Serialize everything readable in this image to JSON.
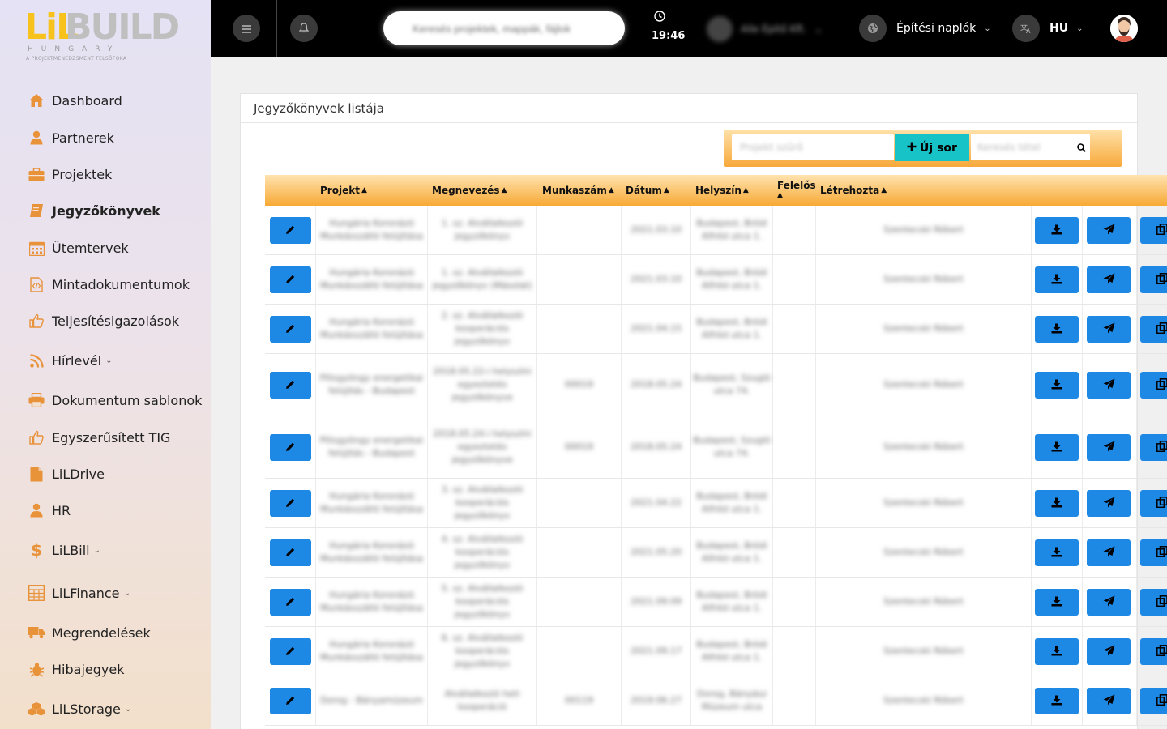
{
  "logo": {
    "mark": "LiL",
    "word": "BUILD",
    "country": "HUNGARY",
    "tagline": "A PROJEKTMENEDZSMENT FELSŐFOKA"
  },
  "sidebar": {
    "items": [
      {
        "label": "Dashboard",
        "icon": "home-icon"
      },
      {
        "label": "Partnerek",
        "icon": "user-icon"
      },
      {
        "label": "Projektek",
        "icon": "briefcase-icon"
      },
      {
        "label": "Jegyzőkönyvek",
        "icon": "book-icon",
        "active": true
      },
      {
        "label": "Ütemtervek",
        "icon": "calendar-icon"
      },
      {
        "label": "Mintadokumentumok",
        "icon": "code-file-icon"
      },
      {
        "label": "Teljesítésigazolások",
        "icon": "thumbs-up-icon"
      },
      {
        "label": "Hírlevél",
        "icon": "rss-icon",
        "caret": true
      },
      {
        "label": "Dokumentum sablonok",
        "icon": "printer-icon"
      },
      {
        "label": "Egyszerűsített TIG",
        "icon": "thumbs-up-icon"
      },
      {
        "label": "LiLDrive",
        "icon": "file-icon"
      },
      {
        "label": "HR",
        "icon": "user-icon"
      },
      {
        "label": "LiLBill",
        "icon": "dollar-icon",
        "caret": true
      },
      {
        "label": "LiLFinance",
        "icon": "calculator-icon",
        "caret": true
      },
      {
        "label": "Megrendelések",
        "icon": "truck-icon"
      },
      {
        "label": "Hibajegyek",
        "icon": "bug-icon"
      },
      {
        "label": "LiLStorage",
        "icon": "cubes-icon",
        "caret": true
      }
    ]
  },
  "topbar": {
    "search_placeholder": "Keresés projektek, mappák, fájlok",
    "time": "19:46",
    "user_name": "Alle Építő Kft.",
    "diaries_label": "Építési naplók",
    "language": "HU"
  },
  "card": {
    "title": "Jegyzőkönyvek listája",
    "filter_placeholder": "Projekt szűrő",
    "new_row_label": "Új sor",
    "search_placeholder": "Keresés tétel"
  },
  "table": {
    "columns": [
      "Projekt",
      "Megnevezés",
      "Munkaszám",
      "Dátum",
      "Helyszín",
      "Felelős",
      "Létrehozta"
    ],
    "rows": [
      {
        "projekt": "Hungária Koronázó Munkásszálló felújítása",
        "megnevezes": "1. sz. Alvállalkozói jegyzőkönyv",
        "munkaszam": "",
        "datum": "2021.03.10",
        "helyszin": "Budapest, Bródi Alfréd utca 1.",
        "felelos": "",
        "letrehozta": "Szentecski Róbert"
      },
      {
        "projekt": "Hungária Koronázó Munkásszálló felújítása",
        "megnevezes": "1. sz. Alvállalkozói jegyzőkönyv (Másolat)",
        "munkaszam": "",
        "datum": "2021.03.10",
        "helyszin": "Budapest, Bródi Alfréd utca 1.",
        "felelos": "",
        "letrehozta": "Szentecski Róbert"
      },
      {
        "projekt": "Hungária Koronázó Munkásszálló felújítása",
        "megnevezes": "2. sz. Alvállalkozói kooperációs jegyzőkönyv",
        "munkaszam": "",
        "datum": "2021.04.15",
        "helyszin": "Budapest, Bródi Alfréd utca 1.",
        "felelos": "",
        "letrehozta": "Szentecski Róbert"
      },
      {
        "projekt": "Pilisgyöngy energetikai felújítás - Budapest",
        "megnevezes": "2018.05.22-i helyszíni egyeztetés jegyzőkönyve",
        "munkaszam": "00019",
        "datum": "2018.05.24",
        "helyszin": "Budapest, Szugló utca 74.",
        "felelos": "",
        "letrehozta": "Szentecski Róbert"
      },
      {
        "projekt": "Pilisgyöngy energetikai felújítás - Budapest",
        "megnevezes": "2018.05.24-i helyszíni egyeztetés jegyzőkönyve",
        "munkaszam": "00019",
        "datum": "2018.05.24",
        "helyszin": "Budapest, Szugló utca 74.",
        "felelos": "",
        "letrehozta": "Szentecski Róbert"
      },
      {
        "projekt": "Hungária Koronázó Munkásszálló felújítása",
        "megnevezes": "3. sz. Alvállalkozói kooperációs jegyzőkönyv",
        "munkaszam": "",
        "datum": "2021.04.22",
        "helyszin": "Budapest, Bródi Alfréd utca 1.",
        "felelos": "",
        "letrehozta": "Szentecski Róbert"
      },
      {
        "projekt": "Hungária Koronázó Munkásszálló felújítása",
        "megnevezes": "4. sz. Alvállalkozói kooperációs jegyzőkönyv",
        "munkaszam": "",
        "datum": "2021.05.20",
        "helyszin": "Budapest, Bródi Alfréd utca 1.",
        "felelos": "",
        "letrehozta": "Szentecski Róbert"
      },
      {
        "projekt": "Hungária Koronázó Munkásszálló felújítása",
        "megnevezes": "5. sz. Alvállalkozói kooperációs jegyzőkönyv",
        "munkaszam": "",
        "datum": "2021.09.09",
        "helyszin": "Budapest, Bródi Alfréd utca 1.",
        "felelos": "",
        "letrehozta": "Szentecski Róbert"
      },
      {
        "projekt": "Hungária Koronázó Munkásszálló felújítása",
        "megnevezes": "6. sz. Alvállalkozói kooperációs jegyzőkönyv",
        "munkaszam": "",
        "datum": "2021.09.17",
        "helyszin": "Budapest, Bródi Alfréd utca 1.",
        "felelos": "",
        "letrehozta": "Szentecski Róbert"
      },
      {
        "projekt": "Dorog - Bányamúzeum",
        "megnevezes": "Alvállalkozói heti kooperáció",
        "munkaszam": "00119",
        "datum": "2019.06.27",
        "helyszin": "Dorog, Bányász Múzeum utca",
        "felelos": "",
        "letrehozta": "Szentecski Róbert"
      }
    ]
  },
  "colors": {
    "accent": "#1e88e5",
    "teal": "#18c3c8",
    "header_orange": "#f7a934"
  }
}
